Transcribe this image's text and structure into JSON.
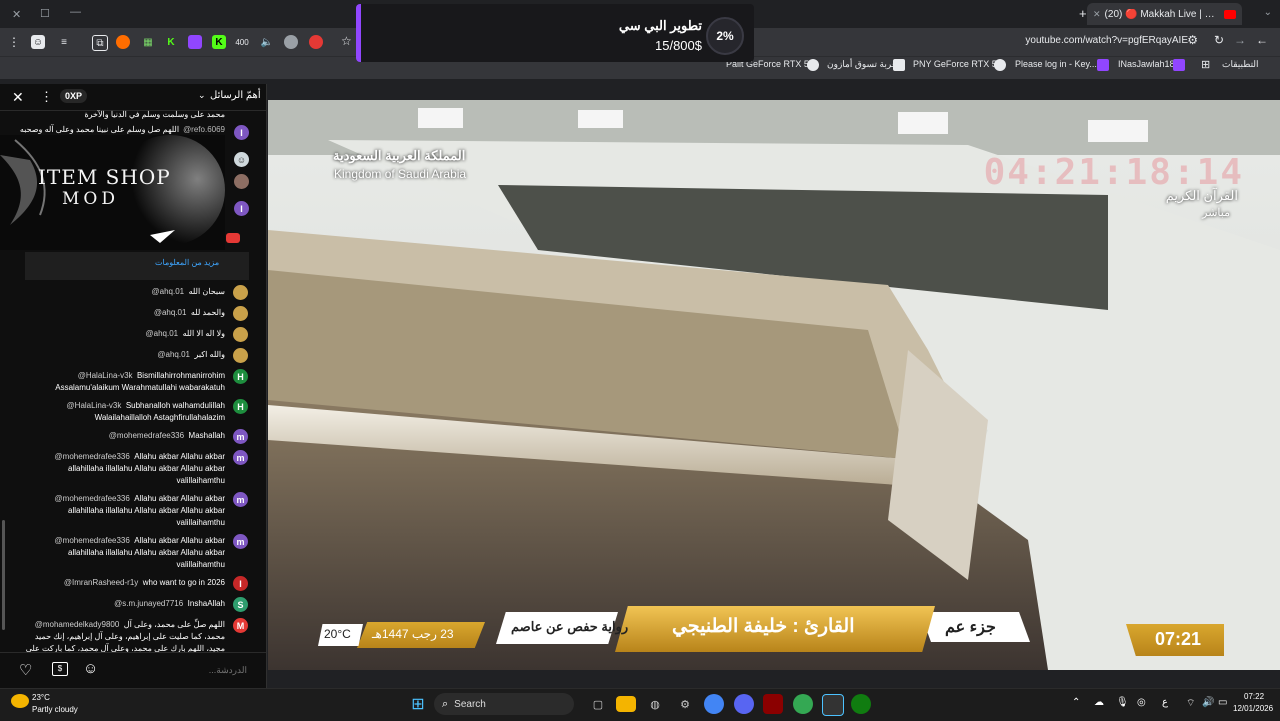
{
  "browser": {
    "active_tab_title": "(20) 🔴 Makkah Live | مكة مباشر",
    "url": "youtube.com/watch?v=pgfERqayAIE",
    "bookmarks": [
      "Palit GeForce RTX 5...",
      "عربة تسوق أمازون",
      "PNY GeForce RTX 5...",
      "Please log in - Key...",
      "INasJawlah18",
      "التطبيقات"
    ]
  },
  "notification": {
    "title": "تطوير البي سي",
    "progress_text": "15/800$",
    "percent_label": "2%",
    "progress": 0.02
  },
  "chat": {
    "header_label": "أهمّ الرسائل",
    "xp_label": "0XP",
    "ad_text_line1": "ITEM SHOP",
    "ad_text_line2": "MOD",
    "more_info": "مزيد من المعلومات",
    "input_placeholder": "الدردشة...",
    "top_messages": [
      {
        "name": "",
        "text": "محمد على وسلمت وسلم في الدنيا والآخرة"
      },
      {
        "name": "@refo.6069",
        "text": "اللهم صل وسلم على نبينا محمد وعلى آله وصحبه"
      }
    ],
    "messages": [
      {
        "name": "@ahq.01",
        "text": "سبحان الله",
        "avatar_color": "#c9a14a",
        "initial": ""
      },
      {
        "name": "@ahq.01",
        "text": "والحمد لله",
        "avatar_color": "#c9a14a",
        "initial": ""
      },
      {
        "name": "@ahq.01",
        "text": "ولا اله الا الله",
        "avatar_color": "#c9a14a",
        "initial": ""
      },
      {
        "name": "@ahq.01",
        "text": "والله اكبر",
        "avatar_color": "#c9a14a",
        "initial": ""
      },
      {
        "name": "@HalaLina-v3k",
        "text": "Bismillahirrohmanirrohim Assalamu'alaikum Warahmatullahi wabarakatuh",
        "avatar_color": "#1e8e3e",
        "initial": "H"
      },
      {
        "name": "@HalaLina-v3k",
        "text": "Subhanalloh walhamdulillah Walailahaillalloh Astaghfirullahalazim",
        "avatar_color": "#1e8e3e",
        "initial": "H"
      },
      {
        "name": "@mohemedrafee336",
        "text": "Mashallah",
        "avatar_color": "#7e57c2",
        "initial": "m"
      },
      {
        "name": "@mohemedrafee336",
        "text": "Allahu akbar Allahu akbar allahillaha illallahu Allahu akbar Allahu akbar valillaihamthu",
        "avatar_color": "#7e57c2",
        "initial": "m"
      },
      {
        "name": "@mohemedrafee336",
        "text": "Allahu akbar Allahu akbar allahillaha illallahu Allahu akbar Allahu akbar valillaihamthu",
        "avatar_color": "#7e57c2",
        "initial": "m"
      },
      {
        "name": "@mohemedrafee336",
        "text": "Allahu akbar Allahu akbar allahillaha illallahu Allahu akbar Allahu akbar valillaihamthu",
        "avatar_color": "#7e57c2",
        "initial": "m"
      },
      {
        "name": "@ImranRasheed-r1y",
        "text": "who want to go in 2026",
        "avatar_color": "#c62828",
        "initial": "I"
      },
      {
        "name": "@s.m.junayed7716",
        "text": "InshaAllah",
        "avatar_color": "#2e9d6e",
        "initial": "S"
      },
      {
        "name": "@mohamedelkady9800",
        "text": "اللهم صلِّ على محمد، وعلى آل محمد، كما صليت على إبراهيم، وعلى آل إبراهيم، إنك حميد مجيد، اللهم بارك على محمد، وعلى آل محمد، كما باركت على إبراهيم، وعلى آل إبراهيم، إنك حميد مجيد",
        "avatar_color": "#e53935",
        "initial": "M"
      }
    ]
  },
  "video": {
    "watermark_ar": "المملكة العربية السعودية",
    "watermark_en": "Kingdom of Saudi Arabia",
    "clock": "04:21:18:14",
    "channel_ar": "القرآن الكريم",
    "live_ar": "مباشر",
    "reciter": "القارئ : خليفة الطنيجي",
    "juz": "جزء عم",
    "narration": "رواية حفص عن عاصم",
    "date": "23 رجب 1447هـ",
    "temp": "20°C",
    "time": "07:21"
  },
  "taskbar": {
    "weather_temp": "23°C",
    "weather_desc": "Partly cloudy",
    "search_label": "Search",
    "lang": "ع",
    "time": "07:22",
    "date": "12/01/2026"
  }
}
